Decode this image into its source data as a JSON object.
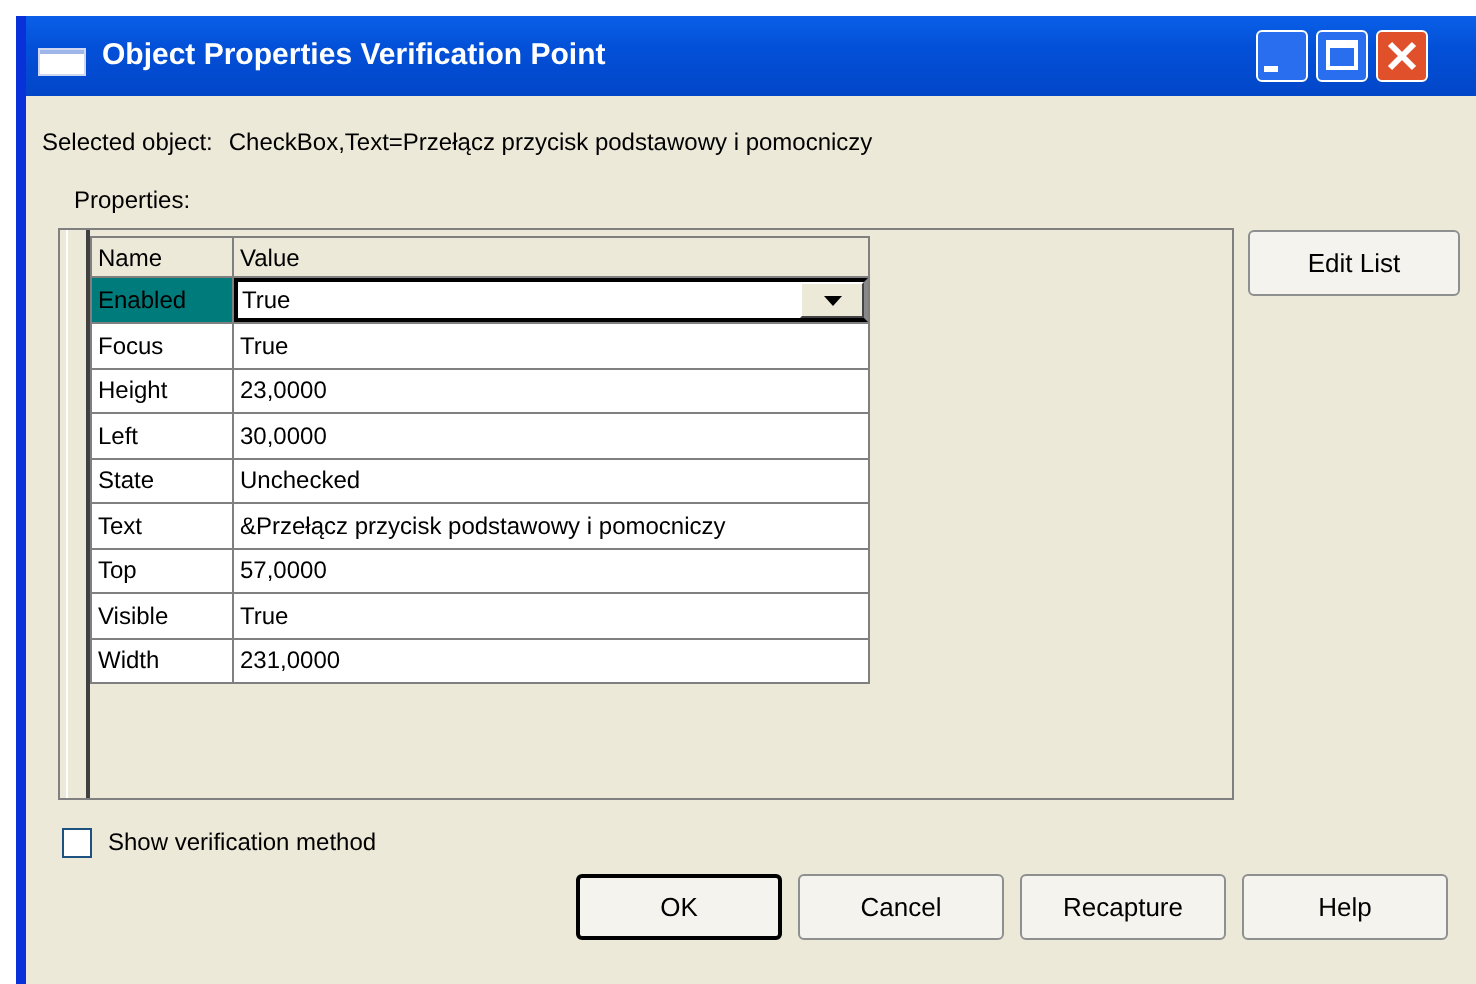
{
  "window": {
    "title": "Object Properties Verification Point"
  },
  "selected_object": {
    "label": "Selected object:",
    "value": "CheckBox,Text=Przełącz przycisk podstawowy i pomocniczy"
  },
  "properties_label": "Properties:",
  "table": {
    "columns": [
      "Name",
      "Value"
    ],
    "rows": [
      {
        "name": "Enabled",
        "value": "True",
        "selected": true
      },
      {
        "name": "Focus",
        "value": "True",
        "selected": false
      },
      {
        "name": "Height",
        "value": "23,0000",
        "selected": false
      },
      {
        "name": "Left",
        "value": "30,0000",
        "selected": false
      },
      {
        "name": "State",
        "value": "Unchecked",
        "selected": false
      },
      {
        "name": "Text",
        "value": "&Przełącz przycisk podstawowy i pomocniczy",
        "selected": false
      },
      {
        "name": "Top",
        "value": "57,0000",
        "selected": false
      },
      {
        "name": "Visible",
        "value": "True",
        "selected": false
      },
      {
        "name": "Width",
        "value": "231,0000",
        "selected": false
      }
    ]
  },
  "edit_list_button": "Edit List",
  "show_verification": {
    "label": "Show verification method",
    "checked": false
  },
  "buttons": [
    {
      "label": "OK",
      "default": true
    },
    {
      "label": "Cancel",
      "default": false
    },
    {
      "label": "Recapture",
      "default": false
    },
    {
      "label": "Help",
      "default": false
    }
  ]
}
